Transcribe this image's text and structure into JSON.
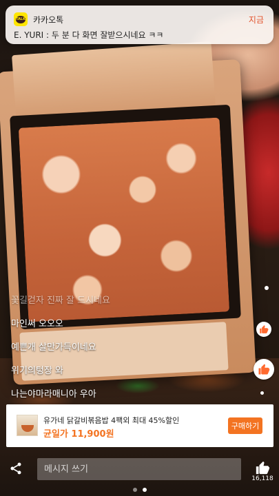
{
  "notification": {
    "app_name": "카카오톡",
    "time": "지금",
    "message": "E. YURI : 두 분 다 화면 잘받으시네요 ㅋㅋ",
    "icon_badge": "TALK",
    "icon": "kakaotalk-icon"
  },
  "comments": [
    {
      "text": "꽃길걷자 진짜 잘 드시네요",
      "faded": true
    },
    {
      "text": "마인써 오오오",
      "faded": false
    },
    {
      "text": "예쁜개 살만가득이네요",
      "faded": false
    },
    {
      "text": "위기의텅장 와",
      "faded": false
    },
    {
      "text": "나는야마라매니아 우아",
      "faded": false
    }
  ],
  "product": {
    "name": "유가네 닭갈비볶음밥 4팩외 최대 45%할인",
    "price": "균일가 11,900원",
    "buy_label": "구매하기",
    "thumbnail": "fried-rice-thumbnail"
  },
  "bottom_bar": {
    "share_icon": "share-icon",
    "message_placeholder": "메시지 쓰기",
    "like_icon": "thumbs-up-icon",
    "like_count": "16,118"
  },
  "pager": {
    "page_count": 2,
    "active_page": 2
  },
  "colors": {
    "accent": "#f37321",
    "notification_time": "#e2532d",
    "kakao_yellow": "#fee500"
  }
}
